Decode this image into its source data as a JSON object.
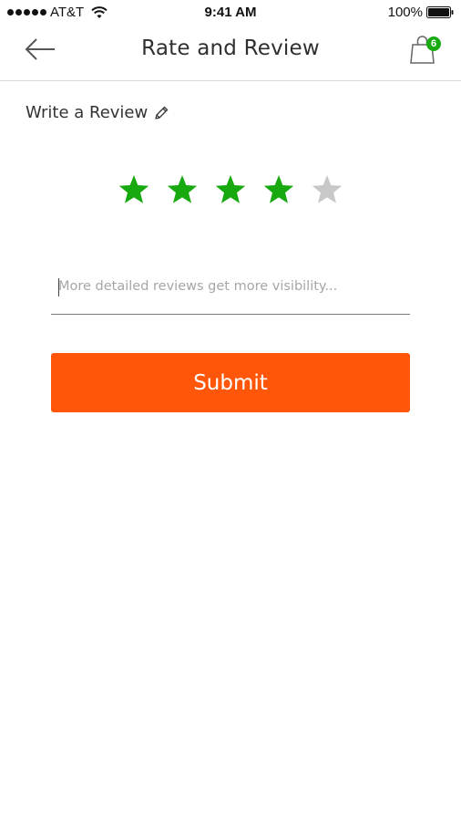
{
  "status_bar": {
    "carrier": "AT&T",
    "time": "9:41 AM",
    "battery": "100%"
  },
  "header": {
    "title": "Rate and Review",
    "back_icon": "arrow-left-icon",
    "cart_icon": "shopping-bag-icon",
    "cart_count": "6"
  },
  "review": {
    "section_title": "Write a Review",
    "section_icon": "pencil-icon",
    "rating": {
      "max": 5,
      "value": 4,
      "filled_color": "#17a90f",
      "empty_color": "#c8c8c8"
    },
    "input_placeholder": "More detailed reviews get more visibility...",
    "input_value": ""
  },
  "actions": {
    "submit_label": "Submit",
    "submit_color": "#ff560a"
  },
  "colors": {
    "accent": "#ff560a",
    "badge": "#1aaa12"
  }
}
